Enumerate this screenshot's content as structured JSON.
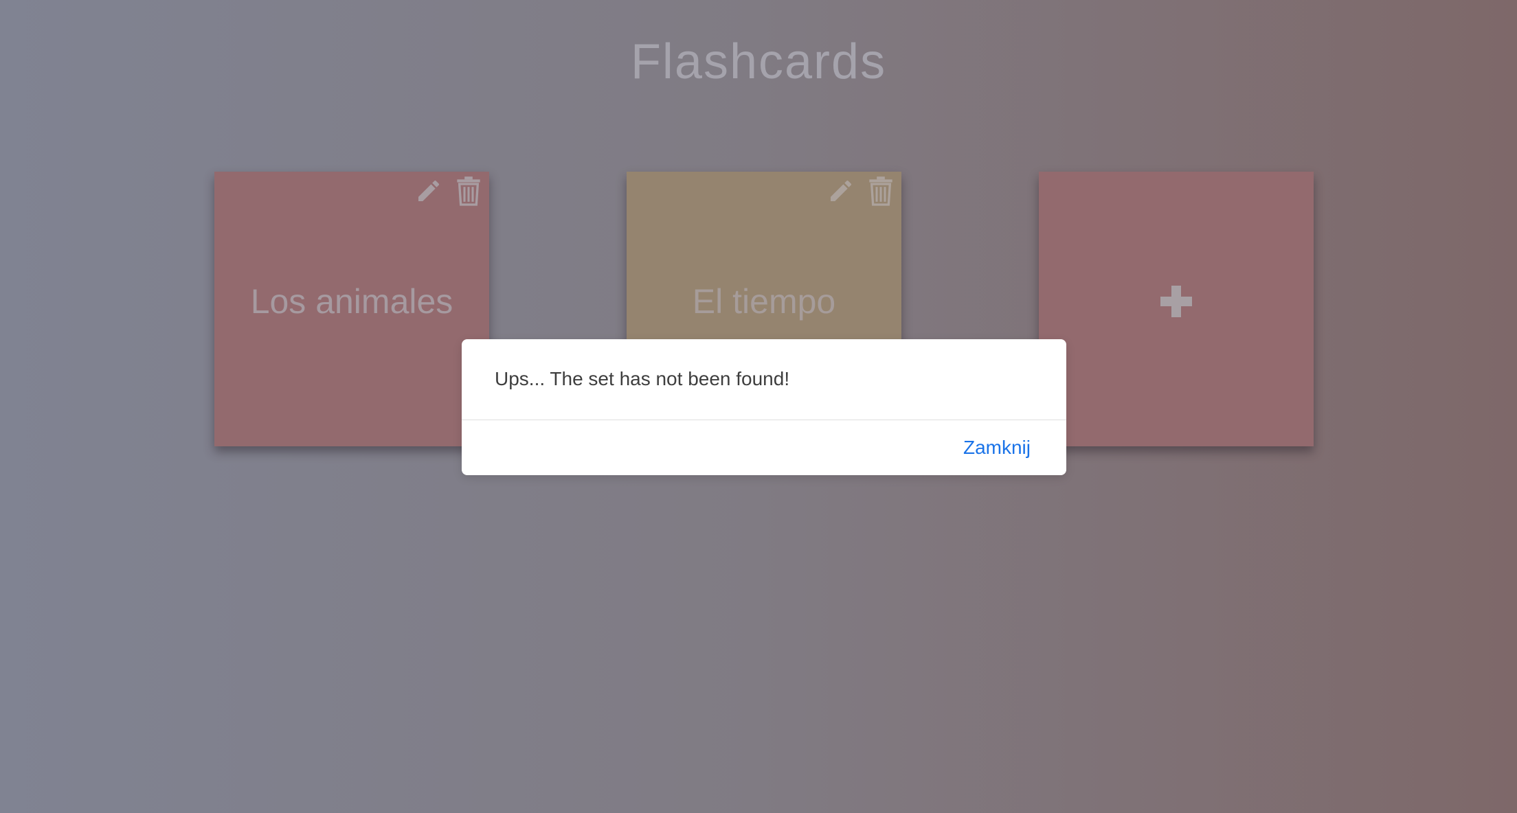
{
  "header": {
    "title": "Flashcards"
  },
  "sets": [
    {
      "name": "Los animales",
      "color": "#936a6e",
      "edit_icon": "pencil-icon",
      "delete_icon": "trash-icon"
    },
    {
      "name": "El tiempo",
      "color": "#95846f",
      "edit_icon": "pencil-icon",
      "delete_icon": "trash-icon"
    }
  ],
  "add_card": {
    "icon": "plus-icon",
    "color": "#936a6e"
  },
  "dialog": {
    "message": "Ups... The set has not been found!",
    "close_label": "Zamknij",
    "link_color": "#1a73e8"
  }
}
